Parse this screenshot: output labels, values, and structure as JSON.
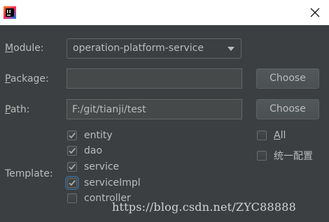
{
  "titlebar": {
    "app_icon": "intellij-idea-icon",
    "close_icon": "close-icon"
  },
  "module": {
    "label_mnemonic": "M",
    "label_rest": "odule:",
    "value": "operation-platform-service"
  },
  "package": {
    "label_mnemonic": "P",
    "label_rest": "ackage:",
    "value": "",
    "button_label": "Choose"
  },
  "path": {
    "label_mnemonic": "P",
    "label_rest": "ath:",
    "value": "F:/git/tianji/test",
    "button_label": "Choose"
  },
  "template": {
    "label": "Template:",
    "items": [
      {
        "label": "entity",
        "checked": true
      },
      {
        "label": "dao",
        "checked": true
      },
      {
        "label": "service",
        "checked": true
      },
      {
        "label": "serviceImpl",
        "checked": true,
        "focused": true
      },
      {
        "label": "controller",
        "checked": false
      }
    ]
  },
  "options": {
    "all_mnemonic": "A",
    "all_rest": "ll",
    "all_checked": false,
    "unified_config_label": "统一配置",
    "unified_config_checked": false
  },
  "watermark": "https://blog.csdn.net/ZYC88888",
  "colors": {
    "background": "#3c3f41",
    "text": "#bbbbbb",
    "checkmark": "#a7a7a7",
    "focus": "#3d6185"
  }
}
